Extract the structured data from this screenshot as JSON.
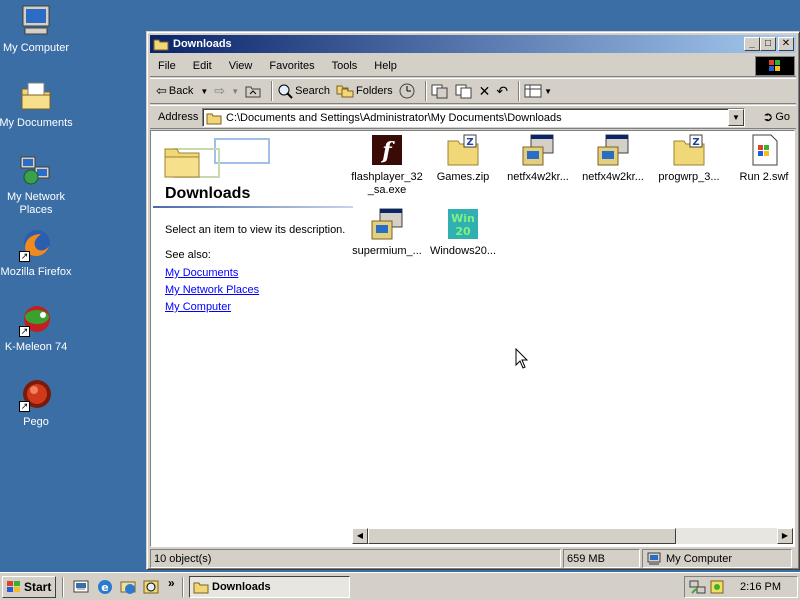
{
  "desktop": {
    "icons": [
      {
        "label": "My Computer",
        "icon": "my-computer-icon"
      },
      {
        "label": "My Documents",
        "icon": "my-documents-icon"
      },
      {
        "label": "My Network Places",
        "icon": "network-places-icon"
      },
      {
        "label": "Mozilla Firefox",
        "icon": "firefox-icon"
      },
      {
        "label": "K-Meleon 74",
        "icon": "kmeleon-icon"
      },
      {
        "label": "Pego",
        "icon": "pego-icon"
      }
    ]
  },
  "window": {
    "title": "Downloads",
    "menu": [
      "File",
      "Edit",
      "View",
      "Favorites",
      "Tools",
      "Help"
    ],
    "toolbar": {
      "back": "Back",
      "search": "Search",
      "folders": "Folders"
    },
    "address": {
      "label": "Address",
      "value": "C:\\Documents and Settings\\Administrator\\My Documents\\Downloads",
      "go": "Go"
    },
    "webview": {
      "title": "Downloads",
      "description": "Select an item to view its description.",
      "see_also": "See also:",
      "links": [
        "My Documents",
        "My Network Places",
        "My Computer"
      ]
    },
    "files": [
      {
        "name": "flashplayer_32_sa.exe",
        "icon": "flash-icon"
      },
      {
        "name": "Games.zip",
        "icon": "zip-folder-icon"
      },
      {
        "name": "netfx4w2kr...",
        "icon": "installer-icon"
      },
      {
        "name": "netfx4w2kr...",
        "icon": "installer-icon"
      },
      {
        "name": "progwrp_3...",
        "icon": "zip-folder-icon"
      },
      {
        "name": "Run 2.swf",
        "icon": "swf-icon"
      },
      {
        "name": "supermium_...",
        "icon": "installer-icon"
      },
      {
        "name": "Windows20...",
        "icon": "win20-icon"
      }
    ],
    "status": {
      "objects": "10 object(s)",
      "size": "659 MB",
      "zone": "My Computer"
    }
  },
  "taskbar": {
    "start": "Start",
    "task": "Downloads",
    "clock": "2:16 PM",
    "overflow": "»"
  },
  "colors": {
    "desktop": "#3a6ea5",
    "title_start": "#0a246a",
    "title_end": "#a6caf0",
    "link": "#0000ff"
  }
}
